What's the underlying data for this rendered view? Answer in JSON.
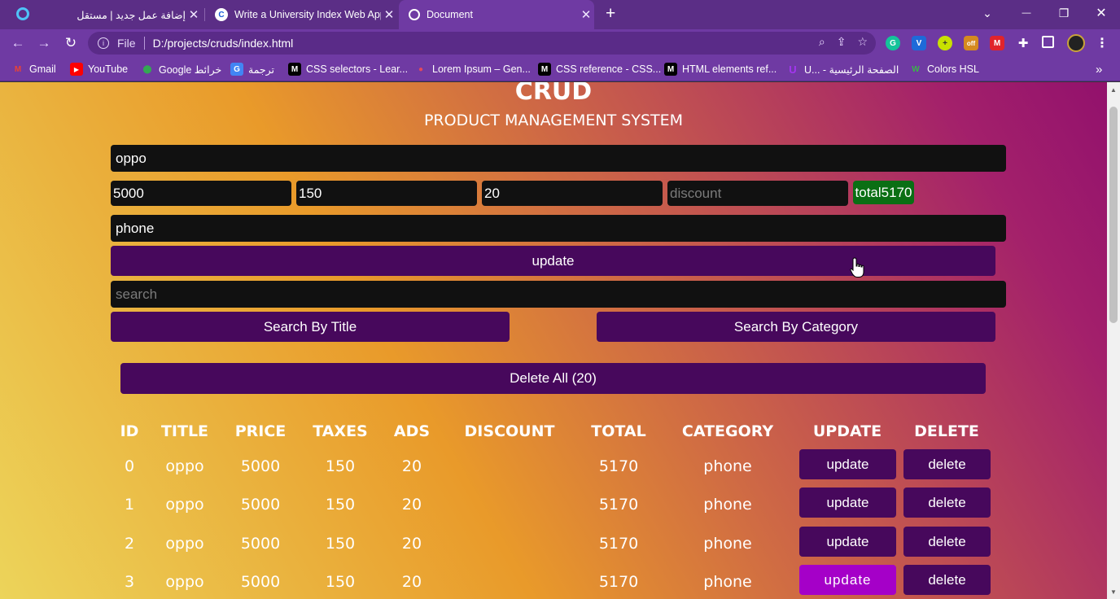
{
  "browser": {
    "tabs": [
      {
        "title": "إضافة عمل جديد | مستقل",
        "close": "✕"
      },
      {
        "title": "Write a University Index Web App",
        "close": "✕"
      },
      {
        "title": "Document",
        "close": "✕"
      }
    ],
    "new_tab": "+",
    "window_controls": {
      "list": "⌄",
      "minimize": "—",
      "restore": "❐",
      "close": "✕"
    },
    "address": {
      "scheme_label": "File",
      "url": "D:/projects/cruds/index.html"
    },
    "bookmarks": [
      {
        "label": "Gmail",
        "icon": "gmail-icon",
        "color": "#ea4335",
        "glyph": "M"
      },
      {
        "label": "YouTube",
        "icon": "youtube-icon",
        "color": "#ff0000",
        "glyph": "▶"
      },
      {
        "label": "Google خرائط",
        "icon": "maps-icon",
        "color": "#34a853",
        "glyph": "⬤"
      },
      {
        "label": "ترجمة",
        "icon": "translate-icon",
        "color": "#4285f4",
        "glyph": "G"
      },
      {
        "label": "CSS selectors - Lear...",
        "icon": "mdn-icon",
        "color": "#000000",
        "glyph": "M"
      },
      {
        "label": "Lorem Ipsum – Gen...",
        "icon": "lorem-icon",
        "color": "#e3495b",
        "glyph": "●"
      },
      {
        "label": "CSS reference - CSS...",
        "icon": "mdn-icon",
        "color": "#000000",
        "glyph": "M"
      },
      {
        "label": "HTML elements ref...",
        "icon": "mdn-icon",
        "color": "#000000",
        "glyph": "M"
      },
      {
        "label": "U... - الصفحة الرئيسية",
        "icon": "udemy-icon",
        "color": "#a435f0",
        "glyph": "U"
      },
      {
        "label": "Colors HSL",
        "icon": "colors-icon",
        "color": "#3bb34a",
        "glyph": "W"
      }
    ],
    "more_bookmarks": "»"
  },
  "page": {
    "title": "CRUD",
    "subtitle": "PRODUCT MANAGEMENT SYSTEM",
    "form": {
      "title_value": "oppo",
      "price_value": "5000",
      "taxes_value": "150",
      "ads_value": "20",
      "discount_placeholder": "discount",
      "total": "total5170",
      "category_value": "phone",
      "submit_label": "update",
      "search_placeholder": "search",
      "search_title_label": "Search By Title",
      "search_category_label": "Search By Category",
      "delete_all_label": "Delete All (20)"
    },
    "table": {
      "headers": [
        "ID",
        "TITLE",
        "PRICE",
        "TAXES",
        "ADS",
        "DISCOUNT",
        "TOTAL",
        "CATEGORY",
        "UPDATE",
        "DELETE"
      ],
      "rows": [
        {
          "id": "0",
          "title": "oppo",
          "price": "5000",
          "taxes": "150",
          "ads": "20",
          "discount": "",
          "total": "5170",
          "category": "phone",
          "update": "update",
          "delete": "delete"
        },
        {
          "id": "1",
          "title": "oppo",
          "price": "5000",
          "taxes": "150",
          "ads": "20",
          "discount": "",
          "total": "5170",
          "category": "phone",
          "update": "update",
          "delete": "delete"
        },
        {
          "id": "2",
          "title": "oppo",
          "price": "5000",
          "taxes": "150",
          "ads": "20",
          "discount": "",
          "total": "5170",
          "category": "phone",
          "update": "update",
          "delete": "delete"
        },
        {
          "id": "3",
          "title": "oppo",
          "price": "5000",
          "taxes": "150",
          "ads": "20",
          "discount": "",
          "total": "5170",
          "category": "phone",
          "update": "update",
          "delete": "delete"
        }
      ]
    }
  },
  "colors": {
    "accent": "#47085c",
    "hover": "#a500c8",
    "total_bg": "#0a6f14",
    "input_bg": "#111111"
  }
}
